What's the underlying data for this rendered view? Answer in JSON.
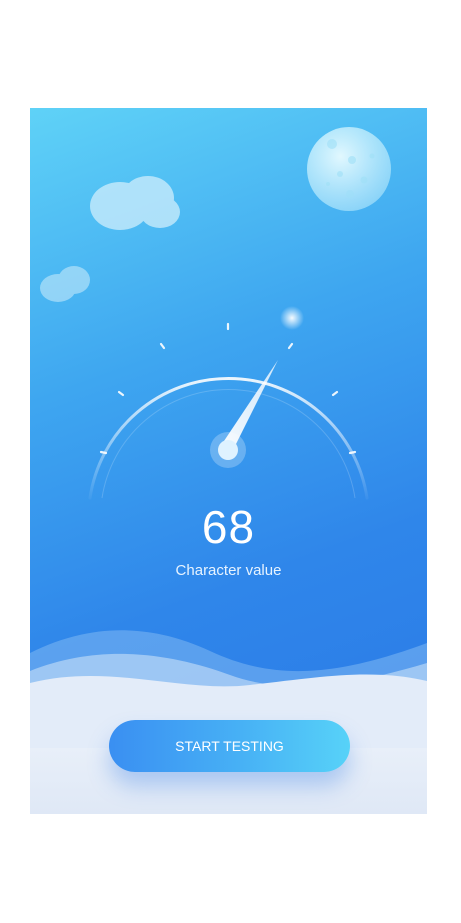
{
  "gauge": {
    "value": "68",
    "label": "Character value"
  },
  "actions": {
    "start_label": "START TESTING"
  },
  "colors": {
    "sky_top": "#5fd2f7",
    "sky_bottom": "#2a78e6",
    "button_left": "#3a8ff2",
    "button_right": "#57d2f8",
    "bottom_panel": "#e6eef8"
  },
  "icons": [
    "moon-icon",
    "cloud-icon",
    "gauge-needle-icon"
  ]
}
